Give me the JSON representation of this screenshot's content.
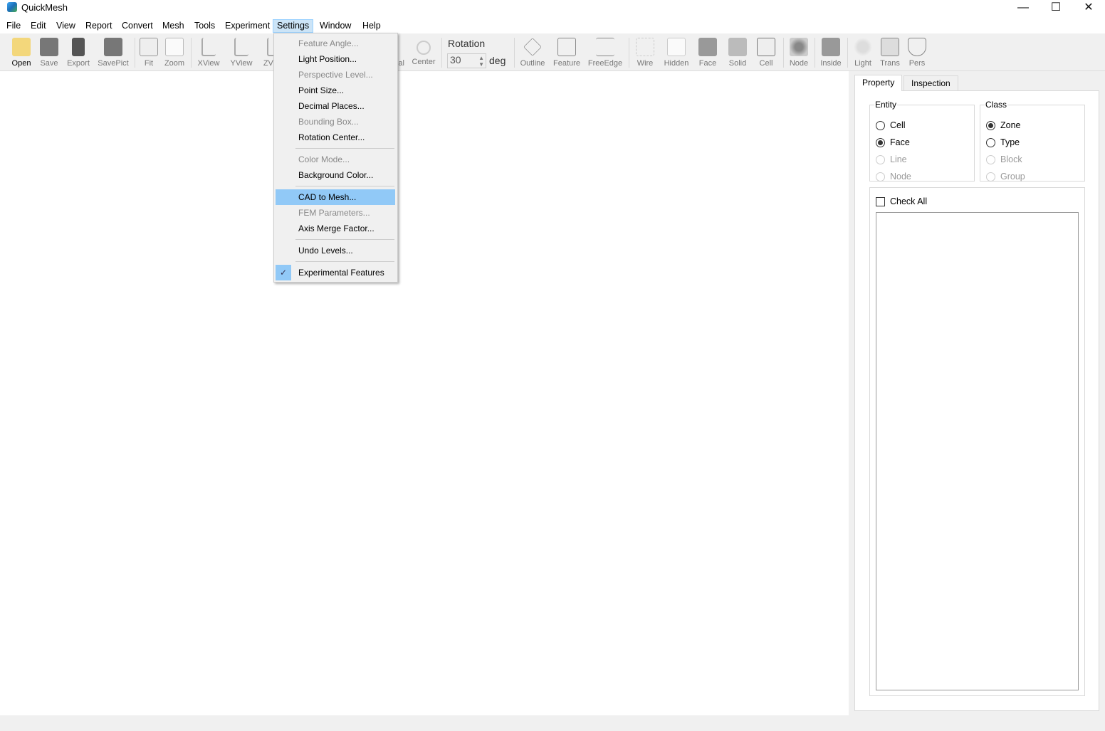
{
  "app": {
    "title": "QuickMesh"
  },
  "window_controls": {
    "minimize": "—",
    "maximize": "☐",
    "close": "✕"
  },
  "menubar": [
    "File",
    "Edit",
    "View",
    "Report",
    "Convert",
    "Mesh",
    "Tools",
    "Experiment",
    "Settings",
    "Window",
    "Help"
  ],
  "toolbar": {
    "buttons": [
      "Open",
      "Save",
      "Export",
      "SavePict",
      "Fit",
      "Zoom",
      "XView",
      "YView",
      "ZView",
      "al",
      "Center",
      "Outline",
      "Feature",
      "FreeEdge",
      "Wire",
      "Hidden",
      "Face",
      "Solid",
      "Cell",
      "Node",
      "Inside",
      "Light",
      "Trans",
      "Pers"
    ],
    "rotation_label": "Rotation",
    "rotation_value": "30",
    "rotation_unit": "deg"
  },
  "settings_menu": {
    "items": [
      {
        "label": "Feature Angle...",
        "enabled": false
      },
      {
        "label": "Light Position...",
        "enabled": true
      },
      {
        "label": "Perspective Level...",
        "enabled": false
      },
      {
        "label": "Point Size...",
        "enabled": true
      },
      {
        "label": "Decimal Places...",
        "enabled": true
      },
      {
        "label": "Bounding Box...",
        "enabled": false
      },
      {
        "label": "Rotation Center...",
        "enabled": true
      },
      {
        "label": "Color Mode...",
        "enabled": false
      },
      {
        "label": "Background Color...",
        "enabled": true
      },
      {
        "label": "CAD to Mesh...",
        "enabled": true,
        "highlighted": true
      },
      {
        "label": "FEM Parameters...",
        "enabled": false
      },
      {
        "label": "Axis Merge Factor...",
        "enabled": true
      },
      {
        "label": "Undo Levels...",
        "enabled": true
      },
      {
        "label": "Experimental Features",
        "enabled": true,
        "checked": true
      }
    ],
    "check": "✓"
  },
  "panel": {
    "tabs": [
      "Property",
      "Inspection"
    ],
    "entity": {
      "title": "Entity",
      "options": [
        "Cell",
        "Face",
        "Line",
        "Node"
      ],
      "selected": "Face"
    },
    "class": {
      "title": "Class",
      "options": [
        "Zone",
        "Type",
        "Block",
        "Group"
      ],
      "selected": "Zone"
    },
    "check_all": "Check All"
  },
  "colors": {
    "highlight": "#91c9f7",
    "menu_active": "#cce4f7"
  }
}
